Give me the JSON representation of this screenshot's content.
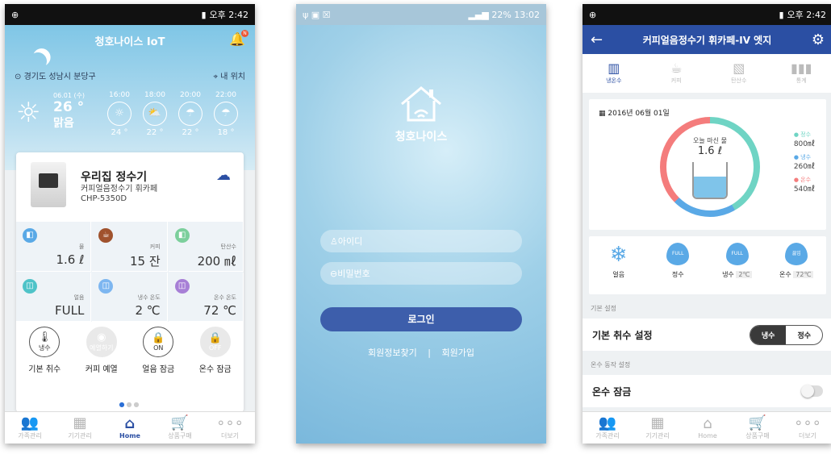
{
  "screen1": {
    "status": {
      "left_icon": "⊕",
      "time": "오후 2:42"
    },
    "title": "청호나이스 IoT",
    "badge": "N",
    "location": "경기도 성남시 분당구",
    "my_location": "내 위치",
    "today": {
      "date": "06.01 (수)",
      "temp": "26 °",
      "weather": "맑음"
    },
    "forecast": [
      {
        "hour": "16:00",
        "temp": "24 °",
        "icon": "☼"
      },
      {
        "hour": "18:00",
        "temp": "22 °",
        "icon": "⛅"
      },
      {
        "hour": "20:00",
        "temp": "22 °",
        "icon": "☂"
      },
      {
        "hour": "22:00",
        "temp": "18 °",
        "icon": "☂"
      }
    ],
    "device": {
      "name": "우리집 정수기",
      "model_line1": "커피얼음정수기 휘카페",
      "model_line2": "CHP-5350D"
    },
    "stats": [
      {
        "label": "물",
        "value": "1.6 ℓ",
        "color": "#5aa9e6",
        "icon": "◧"
      },
      {
        "label": "커피",
        "value": "15 잔",
        "color": "#a0522d",
        "icon": "☕"
      },
      {
        "label": "탄산수",
        "value": "200 ㎖",
        "color": "#7ccf9c",
        "icon": "◧"
      },
      {
        "label": "얼음",
        "value": "FULL",
        "color": "#4fc3c8",
        "icon": "◫"
      },
      {
        "label": "냉수 온도",
        "value": "2 ℃",
        "color": "#7db6f0",
        "icon": "◫"
      },
      {
        "label": "온수 온도",
        "value": "72 ℃",
        "color": "#a77fd6",
        "icon": "◫"
      }
    ],
    "controls": [
      {
        "ring": "냉수",
        "label": "기본 취수",
        "icon": "🌡",
        "off": false
      },
      {
        "ring": "예열하기",
        "label": "커피 예열",
        "icon": "◉",
        "off": true
      },
      {
        "ring": "ON",
        "label": "얼음 잠금",
        "icon": "🔒",
        "off": false
      },
      {
        "ring": "OFF",
        "label": "온수 잠금",
        "icon": "🔒",
        "off": true
      }
    ],
    "nav": [
      {
        "label": "가족관리",
        "icon": "👥"
      },
      {
        "label": "기기관리",
        "icon": "▦"
      },
      {
        "label": "Home",
        "icon": "⌂"
      },
      {
        "label": "상품구매",
        "icon": "🛒"
      },
      {
        "label": "더보기",
        "icon": "∘∘∘"
      }
    ]
  },
  "screen2": {
    "status": {
      "left": "ψ ▣ ☒",
      "right": "22% 13:02"
    },
    "brand": "청호나이스",
    "id_placeholder": "아이디",
    "pw_placeholder": "비밀번호",
    "login": "로그인",
    "find_info": "회원정보찾기",
    "separator": "|",
    "signup": "회원가입"
  },
  "screen3": {
    "status": {
      "left_icon": "⊕",
      "time": "오후 2:42"
    },
    "title": "커피얼음정수기 휘카페-IV 엣지",
    "tabs": [
      {
        "label": "냉온수",
        "icon": "▥"
      },
      {
        "label": "커피",
        "icon": "☕"
      },
      {
        "label": "탄산수",
        "icon": "▧"
      },
      {
        "label": "통계",
        "icon": "▮▮▮"
      }
    ],
    "date": "2016년 06월 01일",
    "today_label": "오늘 마신 물",
    "today_value": "1.6 ℓ",
    "legend": [
      {
        "name": "정수",
        "value": "800㎖",
        "color": "#6fd4c4"
      },
      {
        "name": "냉수",
        "value": "260㎖",
        "color": "#5aa9e6"
      },
      {
        "name": "온수",
        "value": "540㎖",
        "color": "#f47c7c"
      }
    ],
    "status_items": [
      {
        "label": "얼음",
        "value": "",
        "badge": ""
      },
      {
        "label": "정수",
        "value": "",
        "badge": "FULL"
      },
      {
        "label": "냉수",
        "value": "2℃",
        "badge": "FULL"
      },
      {
        "label": "온수",
        "value": "72℃",
        "badge": "끓임"
      }
    ],
    "section_basic": "기본 설정",
    "basic_row": "기본 취수 설정",
    "seg_cold": "냉수",
    "seg_pure": "정수",
    "section_hot": "온수 동작 설정",
    "hot_lock": "온수 잠금"
  }
}
